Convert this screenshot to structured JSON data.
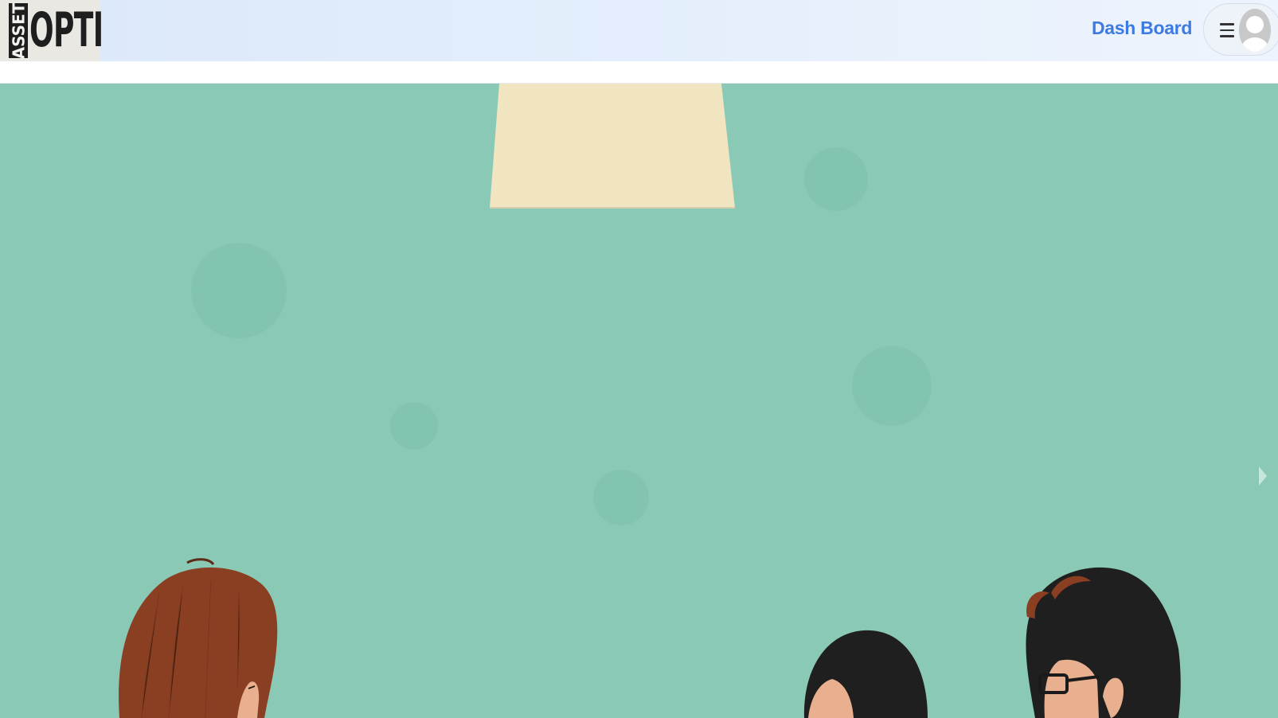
{
  "header": {
    "logo": {
      "vertical_text": "ASSET",
      "main_text": "OPTI"
    },
    "nav": {
      "dashboard_label": "Dash Board"
    },
    "user_menu": {
      "menu_icon": "hamburger-icon",
      "avatar_icon": "user-avatar-icon"
    }
  },
  "hero": {
    "illustration": "teal background with pendant lamp and three people",
    "next_control_icon": "chevron-right-icon"
  },
  "colors": {
    "header_bg": "#e5effc",
    "brand_link": "#3d7be3",
    "hero_bg": "#89c9b5",
    "lamp": "#f0e5c0",
    "hair_brown": "#8a3f22",
    "hair_dark": "#1f1f1f",
    "skin": "#e9b08f"
  }
}
